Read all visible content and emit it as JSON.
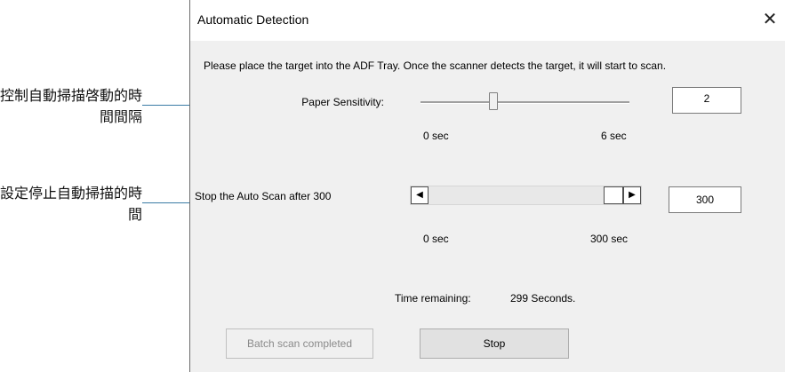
{
  "annotations": {
    "callout_1": "控制自動掃描啓動的時間間隔",
    "callout_2": "設定停止自動掃描的時間"
  },
  "dialog": {
    "title": "Automatic Detection",
    "close_glyph": "✕",
    "instructions": "Please place the target into the ADF Tray. Once the scanner detects the target, it will start to scan.",
    "paper_sensitivity": {
      "label": "Paper Sensitivity:",
      "value": "2",
      "min_label": "0 sec",
      "max_label": "6 sec",
      "slider_min": 0,
      "slider_max": 6,
      "slider_value": 2
    },
    "auto_scan": {
      "label": "Stop the Auto Scan after 300",
      "value": "300",
      "min_label": "0 sec",
      "max_label": "300 sec",
      "scroll_left_glyph": "◀",
      "scroll_right_glyph": "▶",
      "scroll_value": 300
    },
    "status": {
      "label": "Time remaining:",
      "value": "299 Seconds."
    },
    "buttons": {
      "batch_label": "Batch scan completed",
      "stop_label": "Stop"
    }
  },
  "colors": {
    "leader_line": "#3a7ca5",
    "dialog_bg": "#f0f0f0"
  }
}
